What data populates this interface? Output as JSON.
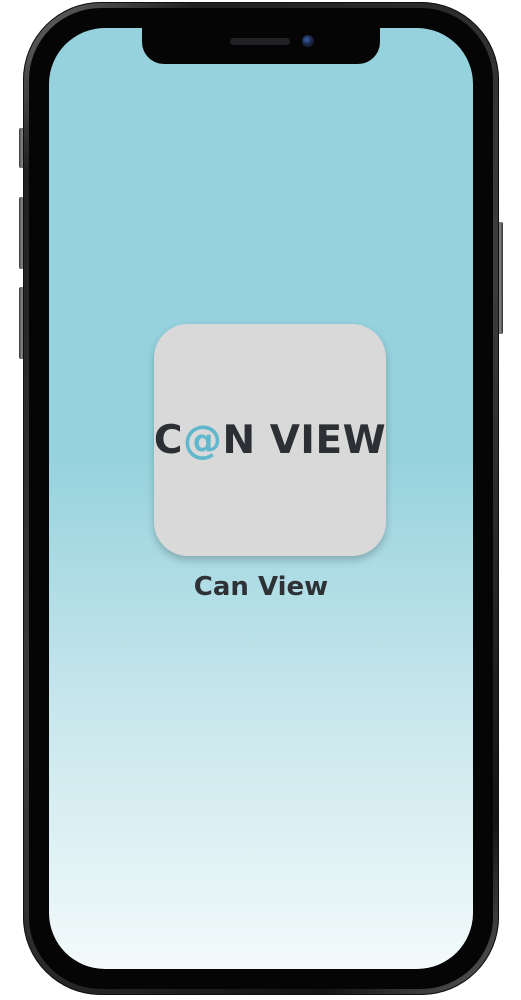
{
  "home_screen": {
    "apps": [
      {
        "icon": {
          "logo_prefix": "C",
          "logo_accent": "@",
          "logo_suffix": "N VIEW",
          "background_color": "#d9d9d9",
          "accent_color": "#5fb8cc"
        },
        "label": "Can View"
      }
    ]
  },
  "device": {
    "type": "phone",
    "wallpaper_colors": [
      "#95d2dd",
      "#c4e5eb",
      "#f3fafb"
    ]
  }
}
